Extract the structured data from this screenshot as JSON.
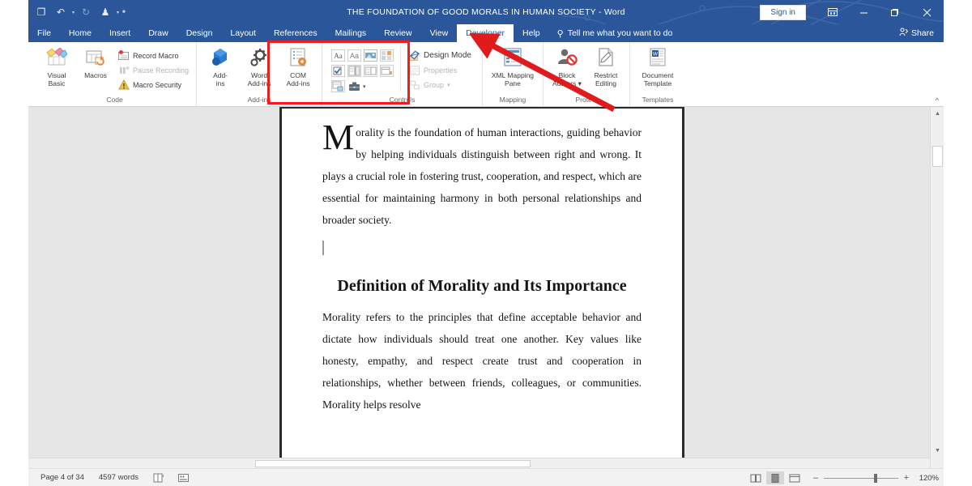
{
  "titlebar": {
    "document_title": "THE FOUNDATION OF GOOD MORALS IN HUMAN SOCIETY",
    "separator": "-",
    "app_name": "Word",
    "quick_access": [
      {
        "name": "save-icon",
        "glyph": "❐"
      },
      {
        "name": "undo-icon",
        "glyph": "↶"
      },
      {
        "name": "redo-icon",
        "glyph": "↻"
      },
      {
        "name": "touch-mode-icon",
        "glyph": "♟"
      },
      {
        "name": "customize-qat-icon",
        "glyph": "▾"
      }
    ],
    "sign_in_label": "Sign in",
    "ribbon_display_options": "❐",
    "minimize": "–",
    "restore": "❐",
    "close": "✕"
  },
  "tabs": [
    {
      "label": "File",
      "active": false
    },
    {
      "label": "Home",
      "active": false
    },
    {
      "label": "Insert",
      "active": false
    },
    {
      "label": "Draw",
      "active": false
    },
    {
      "label": "Design",
      "active": false
    },
    {
      "label": "Layout",
      "active": false
    },
    {
      "label": "References",
      "active": false
    },
    {
      "label": "Mailings",
      "active": false
    },
    {
      "label": "Review",
      "active": false
    },
    {
      "label": "View",
      "active": false
    },
    {
      "label": "Developer",
      "active": true
    },
    {
      "label": "Help",
      "active": false
    }
  ],
  "tellme": {
    "label": "Tell me what you want to do",
    "icon": "lightbulb-icon"
  },
  "share": {
    "label": "Share",
    "icon": "person-share-icon"
  },
  "ribbon": {
    "collapse_label": "^",
    "groups": [
      {
        "name": "code",
        "label": "Code",
        "big_buttons": [
          {
            "label": "Visual\nBasic",
            "line1": "Visual",
            "line2": "Basic",
            "icon": "visual-basic-icon"
          },
          {
            "label": "Macros",
            "line1": "Macros",
            "line2": "",
            "icon": "macros-icon"
          }
        ],
        "small_buttons": [
          {
            "label": "Record Macro",
            "icon": "record-macro-icon",
            "disabled": false
          },
          {
            "label": "Pause Recording",
            "icon": "pause-recording-icon",
            "disabled": true
          },
          {
            "label": "Macro Security",
            "icon": "macro-security-icon",
            "disabled": false
          }
        ]
      },
      {
        "name": "add-ins",
        "label": "Add-ins",
        "big_buttons": [
          {
            "line1": "Add-",
            "line2": "ins",
            "icon": "add-ins-icon"
          },
          {
            "line1": "Word",
            "line2": "Add-ins",
            "icon": "word-add-ins-icon"
          },
          {
            "line1": "COM",
            "line2": "Add-ins",
            "icon": "com-add-ins-icon"
          }
        ],
        "small_buttons": []
      },
      {
        "name": "controls",
        "label": "Controls",
        "highlighted": true,
        "control_icons": [
          {
            "name": "rich-text-content-control-icon",
            "glyph": "Aa"
          },
          {
            "name": "plain-text-content-control-icon",
            "glyph": "Aa"
          },
          {
            "name": "picture-content-control-icon",
            "glyph": "▤"
          },
          {
            "name": "building-block-gallery-content-control-icon",
            "glyph": "▦"
          },
          {
            "name": "check-box-content-control-icon",
            "glyph": "☑"
          },
          {
            "name": "combo-box-content-control-icon",
            "glyph": "▥"
          },
          {
            "name": "drop-down-list-content-control-icon",
            "glyph": "▧"
          },
          {
            "name": "date-picker-content-control-icon",
            "glyph": "▨"
          },
          {
            "name": "repeating-section-content-control-icon",
            "glyph": "▩"
          },
          {
            "name": "legacy-tools-icon",
            "glyph": "⚒"
          }
        ],
        "small_buttons": [
          {
            "label": "Design Mode",
            "icon": "design-mode-icon",
            "disabled": false
          },
          {
            "label": "Properties",
            "icon": "properties-icon",
            "disabled": true
          },
          {
            "label": "Group",
            "icon": "group-icon",
            "disabled": true,
            "dropdown": true
          }
        ]
      },
      {
        "name": "mapping",
        "label": "Mapping",
        "big_buttons": [
          {
            "line1": "XML Mapping",
            "line2": "Pane",
            "icon": "xml-mapping-pane-icon",
            "wide": true
          }
        ],
        "small_buttons": []
      },
      {
        "name": "protect",
        "label": "Protect",
        "big_buttons": [
          {
            "line1": "Block",
            "line2": "Authors ▾",
            "icon": "block-authors-icon"
          },
          {
            "line1": "Restrict",
            "line2": "Editing",
            "icon": "restrict-editing-icon"
          }
        ],
        "small_buttons": []
      },
      {
        "name": "templates",
        "label": "Templates",
        "big_buttons": [
          {
            "line1": "Document",
            "line2": "Template",
            "icon": "document-template-icon"
          }
        ],
        "small_buttons": []
      }
    ]
  },
  "annotations": {
    "box_target_group": "controls",
    "box_color": "#f01d1d",
    "arrow_color": "#e01b1b",
    "arrow_points_to": "controls-group"
  },
  "document": {
    "paragraph1_dropcap": "M",
    "paragraph1": "orality is the foundation of human interactions, guiding behavior by helping individuals distinguish between right and wrong. It plays a crucial role in fostering trust, cooperation, and respect, which are essential for maintaining harmony in both personal relationships and broader society.",
    "heading": "Definition of Morality and Its Importance",
    "paragraph2": "Morality refers to the principles that define acceptable behavior and dictate how individuals should treat one another. Key values like honesty, empathy, and respect create trust and cooperation in relationships, whether between friends, colleagues, or communities. Morality helps resolve"
  },
  "statusbar": {
    "page_info": "Page 4 of 34",
    "word_count": "4597 words",
    "proofing_icon": "spelling-and-grammar-check-icon",
    "language_icon": "accessibility-icon",
    "views": [
      {
        "name": "read-mode-view-button",
        "glyph": "❐",
        "active": false
      },
      {
        "name": "print-layout-view-button",
        "glyph": "▤",
        "active": true
      },
      {
        "name": "web-layout-view-button",
        "glyph": "⬚",
        "active": false
      }
    ],
    "zoom_out": "–",
    "zoom_in": "+",
    "zoom_level": "120%"
  }
}
